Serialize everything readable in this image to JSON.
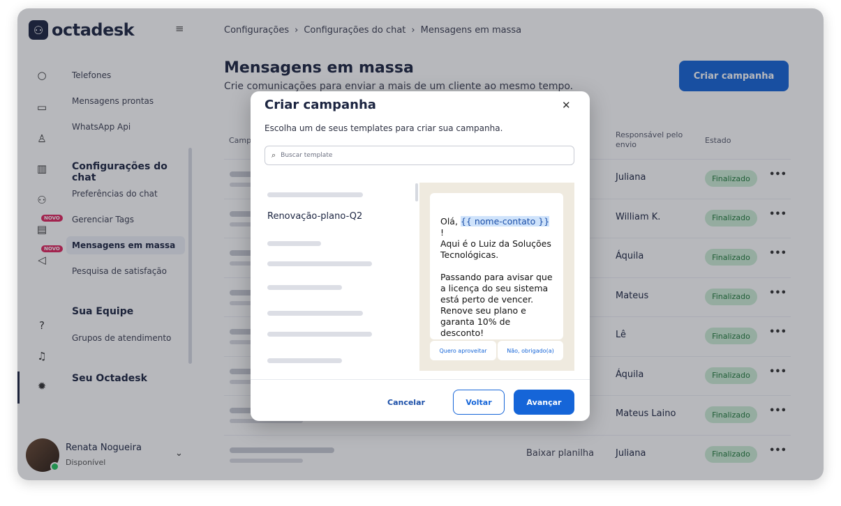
{
  "logo": {
    "mark": "⚇",
    "text": "octadesk"
  },
  "sidebar": {
    "items": [
      {
        "label": "Telefones"
      },
      {
        "label": "Mensagens prontas"
      },
      {
        "label": "WhatsApp Api"
      },
      {
        "label": "Preferências do chat"
      },
      {
        "label": "Gerenciar Tags"
      },
      {
        "label": "Mensagens em massa"
      },
      {
        "label": "Pesquisa de satisfação"
      },
      {
        "label": "Grupos de atendimento"
      }
    ],
    "sections": [
      "Configurações do chat",
      "Sua Equipe",
      "Seu Octadesk"
    ],
    "badge": "NOVO"
  },
  "user": {
    "name": "Renata Nogueira",
    "status": "Disponível"
  },
  "breadcrumb": [
    "Configurações",
    "Configurações do chat",
    "Mensagens em massa"
  ],
  "page": {
    "title": "Mensagens em massa",
    "subtitle": "Crie comunicações para enviar a mais de um cliente ao mesmo tempo.",
    "create_button": "Criar campanha"
  },
  "table": {
    "headers": {
      "campaign": "Camp",
      "responsible": "Responsável pelo envio",
      "state": "Estado"
    },
    "rows": [
      {
        "link": "",
        "responsible": "Juliana",
        "status": "Finalizado"
      },
      {
        "link": "",
        "responsible": "William K.",
        "status": "Finalizado"
      },
      {
        "link": "",
        "responsible": "Áquila",
        "status": "Finalizado"
      },
      {
        "link": "",
        "responsible": "Mateus",
        "status": "Finalizado"
      },
      {
        "link": "",
        "responsible": "Lê",
        "status": "Finalizado"
      },
      {
        "link": "",
        "responsible": "Áquila",
        "status": "Finalizado"
      },
      {
        "link": "",
        "responsible": "Mateus Laino",
        "status": "Finalizado"
      },
      {
        "link": "Baixar planilha",
        "responsible": "Juliana",
        "status": "Finalizado"
      }
    ]
  },
  "modal": {
    "title": "Criar campanha",
    "description": "Escolha um de seus templates para criar sua campanha.",
    "search_placeholder": "Buscar template",
    "template_name": "Renovação-plano-Q2",
    "preview": {
      "greeting_prefix": "Olá,",
      "variable": "{{ nome-contato }}",
      "greeting_suffix": "!",
      "line2": "Aqui é o Luiz da Soluções Tecnológicas.",
      "line3": "Passando para avisar que a licença do seu sistema está perto de vencer. Renove seu plano e garanta 10% de desconto!"
    },
    "quick_replies": [
      "Quero aproveitar",
      "Não, obrigado(a)"
    ],
    "cancel": "Cancelar",
    "back": "Voltar",
    "next": "Avançar"
  }
}
